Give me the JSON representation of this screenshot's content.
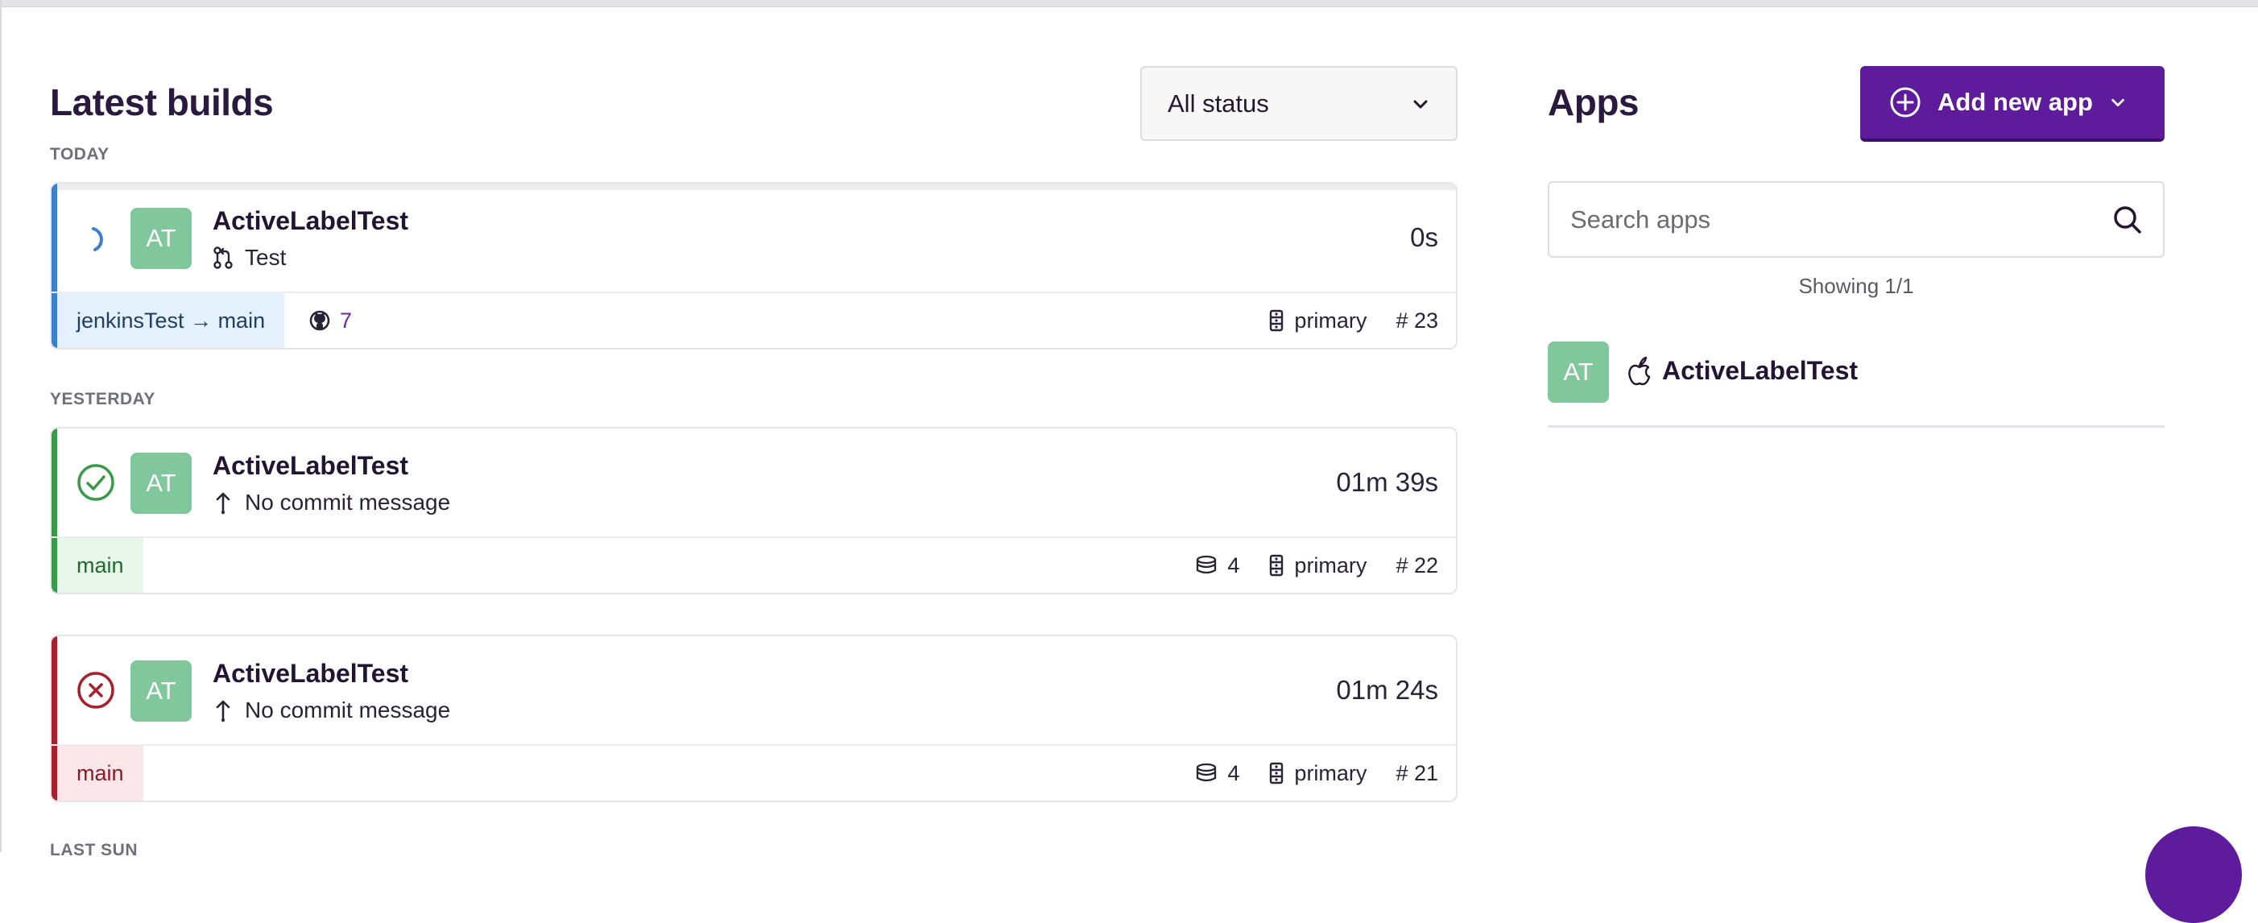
{
  "builds_section": {
    "title": "Latest builds",
    "status_filter": {
      "selected": "All status"
    },
    "groups": [
      {
        "label": "TODAY",
        "builds": [
          {
            "status": "running",
            "avatar": "AT",
            "app_name": "ActiveLabelTest",
            "commit": "Test",
            "duration": "0s",
            "branch": "jenkinsTest → main",
            "pr_number": "7",
            "machine": "primary",
            "build_number": "# 23"
          }
        ]
      },
      {
        "label": "YESTERDAY",
        "builds": [
          {
            "status": "success",
            "avatar": "AT",
            "app_name": "ActiveLabelTest",
            "commit": "No commit message",
            "duration": "01m 39s",
            "branch": "main",
            "artifacts": "4",
            "machine": "primary",
            "build_number": "# 22"
          },
          {
            "status": "failed",
            "avatar": "AT",
            "app_name": "ActiveLabelTest",
            "commit": "No commit message",
            "duration": "01m 24s",
            "branch": "main",
            "artifacts": "4",
            "machine": "primary",
            "build_number": "# 21"
          }
        ]
      },
      {
        "label": "LAST SUN"
      }
    ]
  },
  "apps_section": {
    "title": "Apps",
    "add_button_label": "Add new app",
    "search": {
      "placeholder": "Search apps",
      "value": ""
    },
    "showing_text": "Showing 1/1",
    "apps": [
      {
        "avatar": "AT",
        "platform_icon": "apple-icon",
        "name": "ActiveLabelTest"
      }
    ]
  },
  "colors": {
    "brand_purple": "#5e1c9c",
    "running_blue": "#3b7fd0",
    "success_green": "#3a9a49",
    "failed_red": "#a8202c",
    "avatar_green": "#81c79c"
  }
}
